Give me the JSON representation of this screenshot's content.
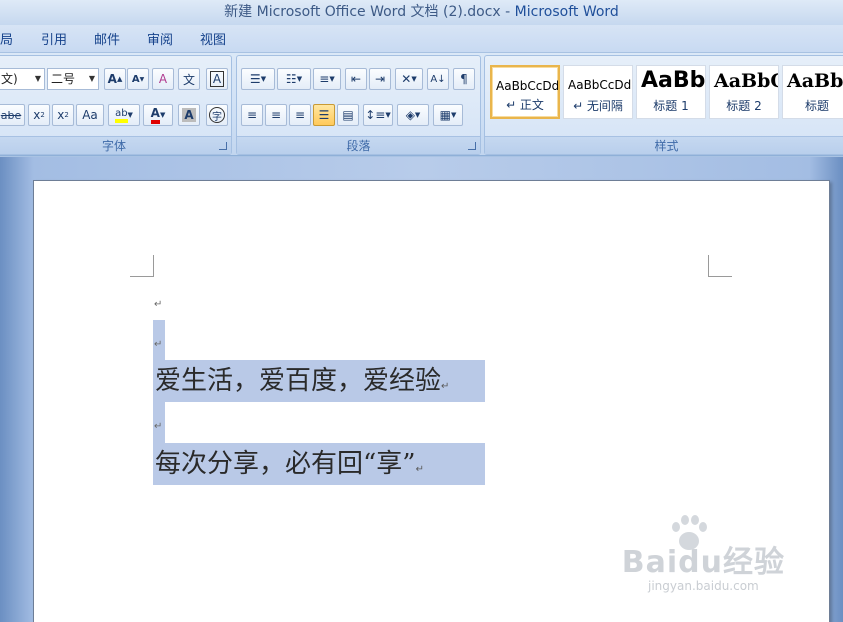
{
  "window": {
    "title_doc": "新建 Microsoft Office Word 文档 (2).docx",
    "title_sep": " - ",
    "title_app": "Microsoft Word"
  },
  "tabs": [
    "局",
    "引用",
    "邮件",
    "审阅",
    "视图"
  ],
  "ribbon": {
    "font_group": {
      "label": "字体",
      "font_name_value": "文)",
      "font_size_value": "二号",
      "buttons": {
        "grow": "A",
        "shrink": "A",
        "clear_format": "A",
        "phonetic": "文",
        "char_border": "A",
        "strikethrough": "abe",
        "subscript": "x",
        "superscript": "x",
        "change_case": "Aa",
        "highlight": "ab",
        "font_color": "A",
        "char_shading": "A",
        "enclose": "字"
      }
    },
    "paragraph_group": {
      "label": "段落"
    },
    "styles_group": {
      "label": "样式",
      "styles": [
        {
          "sample": "AaBbCcDd",
          "name": "↵ 正文",
          "selected": true
        },
        {
          "sample": "AaBbCcDd",
          "name": "↵ 无间隔",
          "selected": false
        },
        {
          "sample": "AaBb",
          "name": "标题 1",
          "selected": false
        },
        {
          "sample": "AaBbC",
          "name": "标题 2",
          "selected": false
        },
        {
          "sample": "AaBbC",
          "name": "标题",
          "selected": false
        }
      ]
    }
  },
  "document": {
    "paragraph_mark": "↵",
    "lines": [
      "爱生活，爱百度，爱经验",
      "每次分享，必有回“享”"
    ],
    "selection_color": "#b9c9e7"
  },
  "watermark": {
    "logo_text": "Baidu经验",
    "url": "jingyan.baidu.com"
  }
}
